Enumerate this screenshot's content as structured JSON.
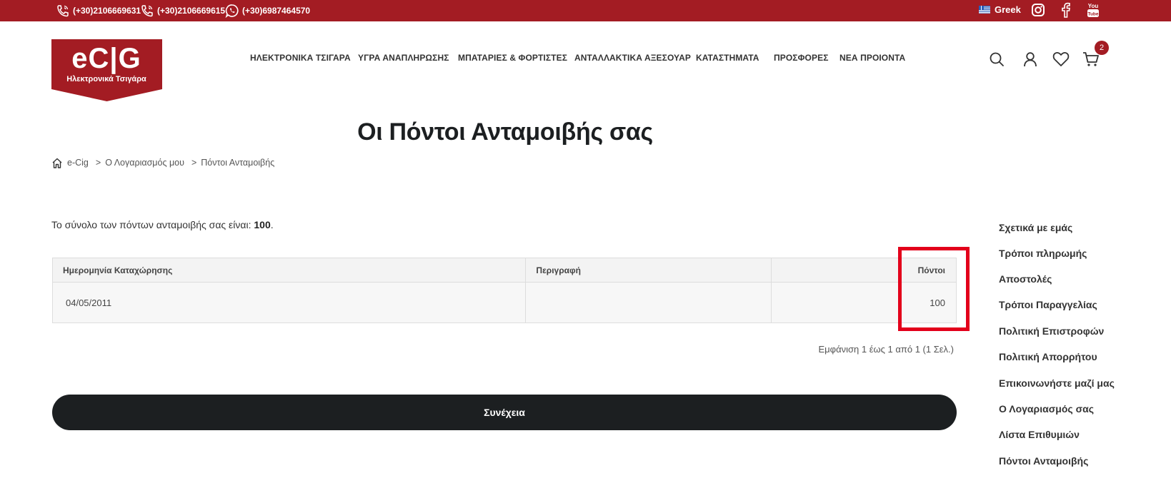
{
  "topbar": {
    "phones": [
      "(+30)2106669631",
      "(+30)2106669615",
      "(+30)6987464570"
    ],
    "language": "Greek"
  },
  "logo": {
    "brand": "eCIG",
    "tagline": "Ηλεκτρονικά Τσιγάρα"
  },
  "nav": {
    "items": [
      "ΗΛΕΚΤΡΟΝΙΚΑ ΤΣΙΓΑΡΑ",
      "ΥΓΡΑ ΑΝΑΠΛΗΡΩΣΗΣ",
      "ΜΠΑΤΑΡΙΕΣ & ΦΟΡΤΙΣΤΕΣ",
      "ΑΝΤΑΛΛΑΚΤΙΚΑ ΑΞΕΣΟΥΑΡ",
      "ΚΑΤΑΣΤΗΜΑΤΑ",
      "ΠΡΟΣΦΟΡΕΣ",
      "ΝΕΑ ΠΡΟΙΟΝΤΑ"
    ]
  },
  "cart": {
    "count": "2"
  },
  "page": {
    "title": "Οι Πόντοι Ανταμοιβής σας",
    "breadcrumb": [
      "e-Cig",
      "Ο Λογαριασμός μου",
      "Πόντοι Ανταμοιβής"
    ],
    "breadcrumb_sep": ">",
    "total_prefix": "Το σύνολο των πόντων ανταμοιβής σας είναι:",
    "total_value": "100",
    "total_suffix": "."
  },
  "table": {
    "headers": [
      "Ημερομηνία Καταχώρησης",
      "Περιγραφή",
      "",
      "Πόντοι"
    ],
    "rows": [
      {
        "date": "04/05/2011",
        "description": "",
        "extra": "",
        "points": "100"
      }
    ]
  },
  "pagination": "Εμφάνιση 1 έως 1 από 1 (1 Σελ.)",
  "continue_label": "Συνέχεια",
  "sidebar": {
    "items": [
      "Σχετικά με εμάς",
      "Τρόποι πληρωμής",
      "Αποστολές",
      "Τρόποι Παραγγελίας",
      "Πολιτική Επιστροφών",
      "Πολιτική Απορρήτου",
      "Επικοινωνήστε μαζί μας",
      "Ο Λογαριασμός σας",
      "Λίστα Επιθυμιών",
      "Πόντοι Ανταμοιβής"
    ]
  },
  "colors": {
    "brand": "#a31c23",
    "button": "#1c1f21",
    "highlight": "#e3001b"
  },
  "icons": [
    "phone-icon",
    "whatsapp-icon",
    "flag-icon",
    "instagram-icon",
    "facebook-icon",
    "youtube-icon",
    "search-icon",
    "user-icon",
    "heart-icon",
    "cart-icon",
    "home-icon"
  ]
}
